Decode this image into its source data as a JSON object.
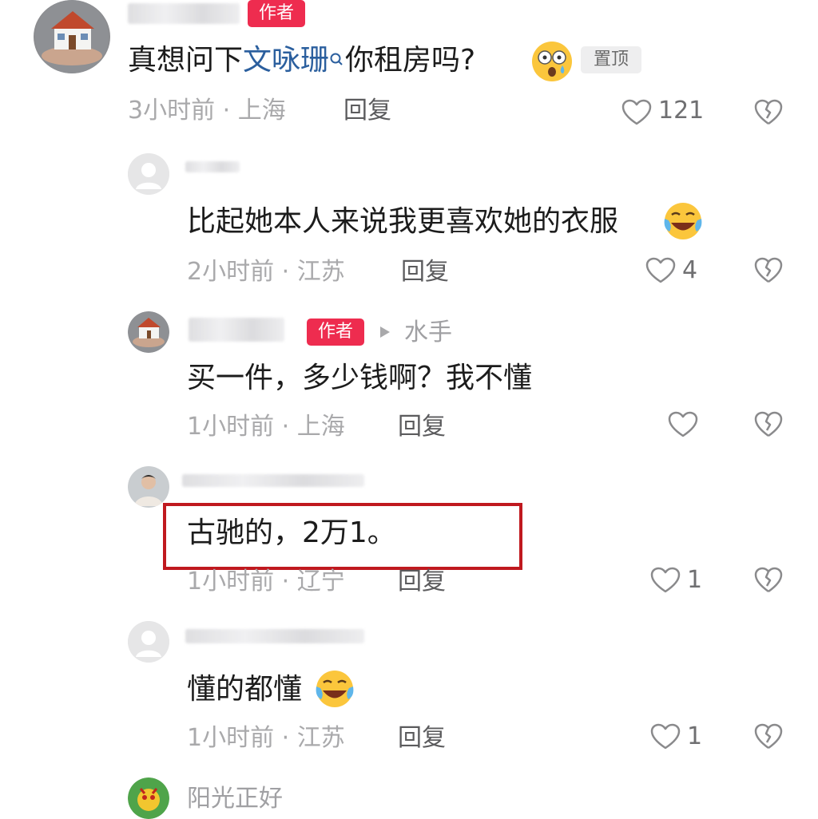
{
  "colors": {
    "author_tag": "#ee2c4f",
    "mention": "#2b5f9e",
    "highlight_border": "#c0191f",
    "meta_gray": "#a9a9ab"
  },
  "comments": [
    {
      "author_tag": "作者",
      "text_before": "真想问下",
      "mention": "文咏珊",
      "text_after": "你租房吗?",
      "emoji": "shocked-face-icon",
      "pin_label": "置顶",
      "time_location": "3小时前 · 上海",
      "reply_label": "回复",
      "like_count": "121"
    },
    {
      "text": "比起她本人来说我更喜欢她的衣服",
      "emoji": "laughing-crying-face-icon",
      "time_location": "2小时前 · 江苏",
      "reply_label": "回复",
      "like_count": "4"
    },
    {
      "author_tag": "作者",
      "reply_to": "水手",
      "text": "买一件，多少钱啊？我不懂",
      "time_location": "1小时前 · 上海",
      "reply_label": "回复",
      "like_count": ""
    },
    {
      "text": "古驰的，2万1。",
      "time_location": "1小时前 · 辽宁",
      "reply_label": "回复",
      "like_count": "1"
    },
    {
      "text": "懂的都懂",
      "emoji": "laughing-crying-face-icon",
      "time_location": "1小时前 · 江苏",
      "reply_label": "回复",
      "like_count": "1"
    },
    {
      "username": "阳光正好"
    }
  ]
}
